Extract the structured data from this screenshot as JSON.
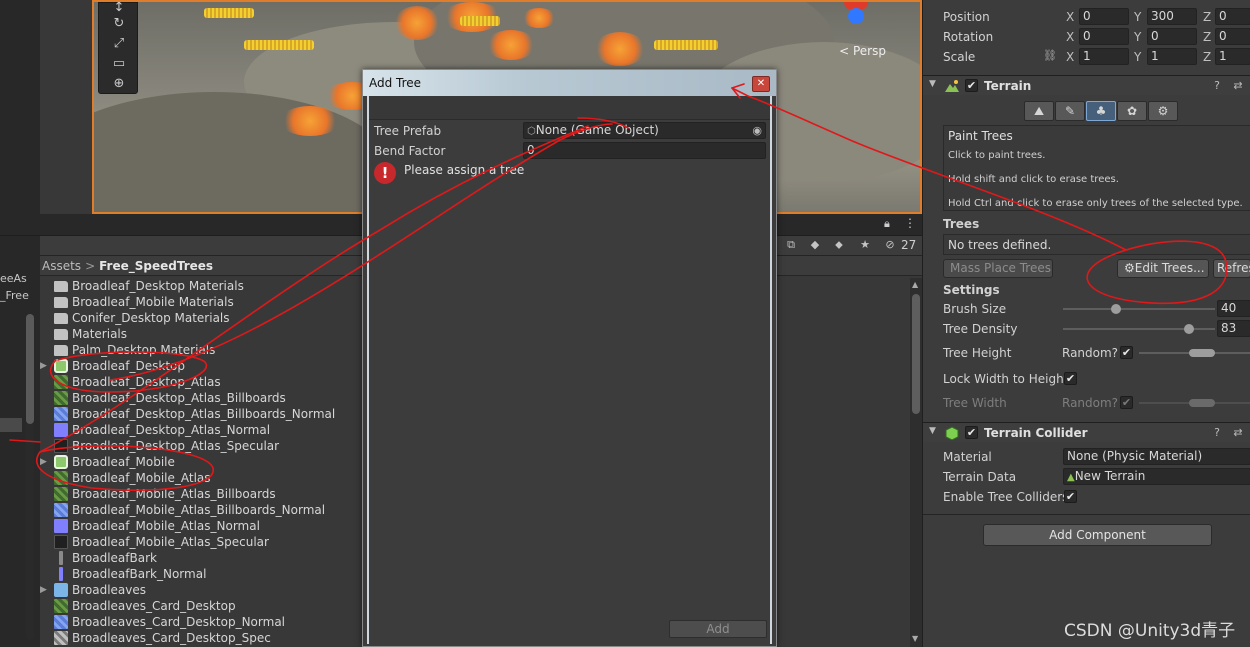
{
  "left_strip": {
    "label1": "eeAs",
    "label2": "_Free"
  },
  "scene": {
    "persp_label": "< Persp",
    "tools": [
      "move-tool",
      "rotate-tool",
      "scale-tool",
      "rect-tool",
      "transform-tool"
    ]
  },
  "project": {
    "breadcrumb": {
      "root": "Assets",
      "separator": ">",
      "folder": "Free_SpeedTrees"
    },
    "toolbar": {
      "hidden_count": "27"
    },
    "assets": [
      {
        "name": "Broadleaf_Desktop Materials",
        "type": "folder",
        "arrow": false
      },
      {
        "name": "Broadleaf_Mobile Materials",
        "type": "folder",
        "arrow": false
      },
      {
        "name": "Conifer_Desktop Materials",
        "type": "folder",
        "arrow": false
      },
      {
        "name": "Materials",
        "type": "folder",
        "arrow": false
      },
      {
        "name": "Palm_Desktop Materials",
        "type": "folder",
        "arrow": false
      },
      {
        "name": "Broadleaf_Desktop",
        "type": "prefab",
        "arrow": true
      },
      {
        "name": "Broadleaf_Desktop_Atlas",
        "type": "tex-green",
        "arrow": false
      },
      {
        "name": "Broadleaf_Desktop_Atlas_Billboards",
        "type": "tex-green",
        "arrow": false
      },
      {
        "name": "Broadleaf_Desktop_Atlas_Billboards_Normal",
        "type": "tex-blue",
        "arrow": false
      },
      {
        "name": "Broadleaf_Desktop_Atlas_Normal",
        "type": "tex-normal",
        "arrow": false
      },
      {
        "name": "Broadleaf_Desktop_Atlas_Specular",
        "type": "tex-dark",
        "arrow": false
      },
      {
        "name": "Broadleaf_Mobile",
        "type": "prefab",
        "arrow": true
      },
      {
        "name": "Broadleaf_Mobile_Atlas",
        "type": "tex-green",
        "arrow": false
      },
      {
        "name": "Broadleaf_Mobile_Atlas_Billboards",
        "type": "tex-green",
        "arrow": false
      },
      {
        "name": "Broadleaf_Mobile_Atlas_Billboards_Normal",
        "type": "tex-blue",
        "arrow": false
      },
      {
        "name": "Broadleaf_Mobile_Atlas_Normal",
        "type": "tex-normal",
        "arrow": false
      },
      {
        "name": "Broadleaf_Mobile_Atlas_Specular",
        "type": "tex-dark",
        "arrow": false
      },
      {
        "name": "BroadleafBark",
        "type": "bark",
        "arrow": false
      },
      {
        "name": "BroadleafBark_Normal",
        "type": "bark-n",
        "arrow": false
      },
      {
        "name": "Broadleaves",
        "type": "model",
        "arrow": true
      },
      {
        "name": "Broadleaves_Card_Desktop",
        "type": "tex-green",
        "arrow": false
      },
      {
        "name": "Broadleaves_Card_Desktop_Normal",
        "type": "tex-blue",
        "arrow": false
      },
      {
        "name": "Broadleaves_Card_Desktop_Spec",
        "type": "tex-white",
        "arrow": false
      }
    ]
  },
  "inspector": {
    "transform": {
      "position": {
        "label": "Position",
        "x": "0",
        "y": "300",
        "z": "0"
      },
      "rotation": {
        "label": "Rotation",
        "x": "0",
        "y": "0",
        "z": "0"
      },
      "scale": {
        "label": "Scale",
        "x": "1",
        "y": "1",
        "z": "1"
      },
      "axis_x": "X",
      "axis_y": "Y",
      "axis_z": "Z"
    },
    "terrain": {
      "title": "Terrain",
      "tools": [
        "raise-terrain",
        "paint-texture",
        "paint-trees",
        "paint-details",
        "terrain-settings"
      ],
      "active_tool": 2,
      "paint_trees": {
        "title": "Paint Trees",
        "line1": "Click to paint trees.",
        "line2": "Hold shift and click to erase trees.",
        "line3": "Hold Ctrl and click to erase only trees of the selected type."
      },
      "trees_section": "Trees",
      "no_trees": "No trees defined.",
      "mass_place": "Mass Place Trees",
      "edit_trees": "Edit Trees...",
      "refresh": "Refresh",
      "settings": "Settings",
      "brush_size": {
        "label": "Brush Size",
        "value": "40",
        "fraction": 0.35
      },
      "tree_density": {
        "label": "Tree Density",
        "value": "83",
        "fraction": 0.83
      },
      "tree_height": {
        "label": "Tree Height",
        "random": "Random?"
      },
      "lock_width": {
        "label": "Lock Width to Height"
      },
      "tree_width": {
        "label": "Tree Width",
        "random": "Random?"
      }
    },
    "terrain_collider": {
      "title": "Terrain Collider",
      "material": {
        "label": "Material",
        "value": "None (Physic Material)"
      },
      "terrain_data": {
        "label": "Terrain Data",
        "value": "New Terrain"
      },
      "enable_tree_colliders": {
        "label": "Enable Tree Colliders"
      }
    },
    "add_component": "Add Component"
  },
  "dialog": {
    "title": "Add Tree",
    "close": "✕",
    "tree_prefab": {
      "label": "Tree Prefab",
      "value": "None (Game Object)"
    },
    "bend_factor": {
      "label": "Bend Factor",
      "value": "0"
    },
    "warning": "Please assign a tree",
    "add_button": "Add"
  },
  "watermark": "CSDN @Unity3d青子",
  "colors": {
    "panel": "#3c3c3c",
    "scene_border": "#e07d2a",
    "annotation": "#e0181a"
  }
}
